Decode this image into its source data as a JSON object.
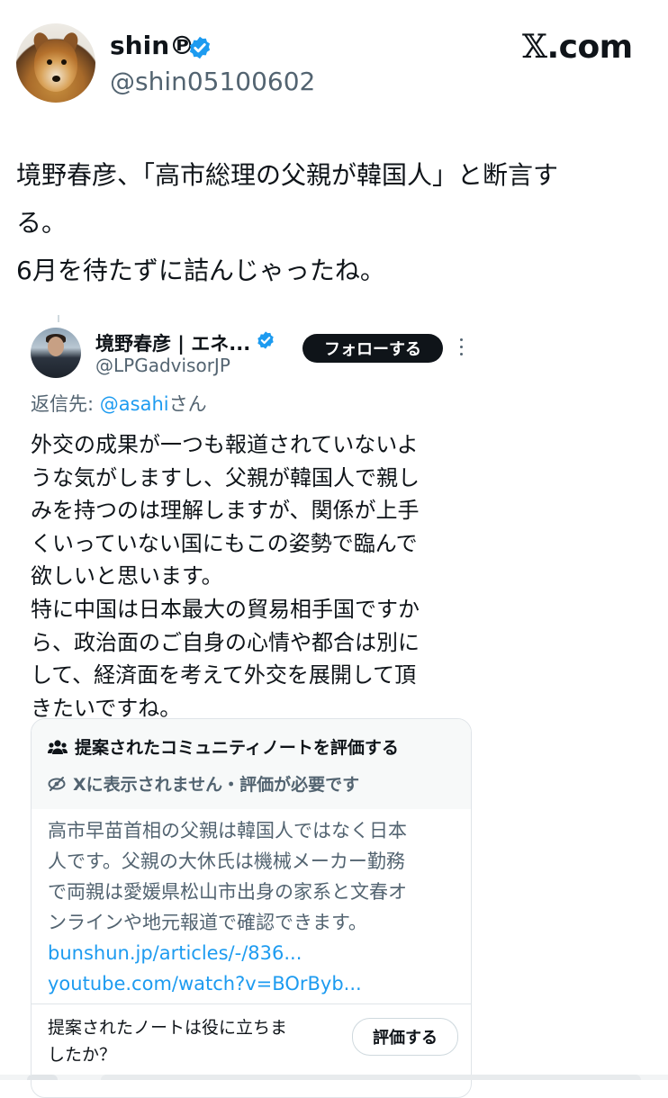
{
  "header": {
    "display_name": "shin℗",
    "handle": "@shin05100602",
    "site_label_glyph": "𝕏",
    "site_label_text": ".com",
    "verified_icon": "verified-badge-icon",
    "verified_color": "#1d9bf0"
  },
  "post": {
    "lines": [
      "境野春彦、「高市総理の父親が韓国人」と断言す",
      "る。",
      "6月を待たずに詰んじゃったね。"
    ]
  },
  "quoted": {
    "display_name": "境野春彦 | エネ...",
    "handle": "@LPGadvisorJP",
    "follow_label": "フォローする",
    "reply_prefix": "返信先: ",
    "reply_mention": "@asahi",
    "reply_suffix": "さん",
    "lines": [
      "外交の成果が一つも報道されていないよ",
      "うな気がしますし、父親が韓国人で親し",
      "みを持つのは理解しますが、関係が上手",
      "くいっていない国にもこの姿勢で臨んで",
      "欲しいと思います。",
      "特に中国は日本最大の貿易相手国ですか",
      "ら、政治面のご自身の心情や都合は別に",
      "して、経済面を考えて外交を展開して頂",
      "きたいですね。"
    ]
  },
  "community_note": {
    "title": "提案されたコミュニティノートを評価する",
    "status": "Xに表示されません・評価が必要です",
    "body_lines": [
      "高市早苗首相の父親は韓国人ではなく日本",
      "人です。父親の大休氏は機械メーカー勤務",
      "で両親は愛媛県松山市出身の家系と文春オ",
      "ンラインや地元報道で確認できます。"
    ],
    "links": [
      "bunshun.jp/articles/-/836...",
      "youtube.com/watch?v=BOrByb..."
    ],
    "question_lines": [
      "提案されたノートは役に立ちま",
      "したか？"
    ],
    "rate_label": "評価する",
    "link_color": "#1d9bf0"
  }
}
